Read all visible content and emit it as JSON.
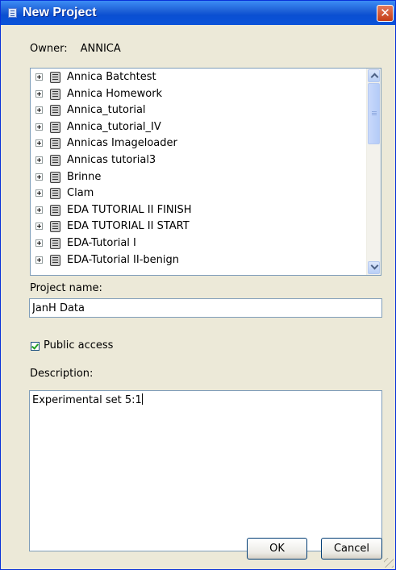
{
  "window": {
    "title": "New Project",
    "close_glyph": "✕"
  },
  "owner": {
    "label": "Owner:",
    "value": "ANNICA"
  },
  "projects": [
    "Annica Batchtest",
    "Annica Homework",
    "Annica_tutorial",
    "Annica_tutorial_IV",
    "Annicas Imageloader",
    "Annicas tutorial3",
    "Brinne",
    "Clam",
    "EDA TUTORIAL II FINISH",
    "EDA TUTORIAL II START",
    "EDA-Tutorial I",
    "EDA-Tutorial II-benign"
  ],
  "project_name": {
    "label": "Project name:",
    "value": "JanH Data"
  },
  "public_access": {
    "label": "Public access",
    "checked": true
  },
  "description": {
    "label": "Description:",
    "value": "Experimental set 5:1"
  },
  "buttons": {
    "ok": "OK",
    "cancel": "Cancel"
  },
  "icons": {
    "title": "database-window-icon",
    "project": "database-icon",
    "expander": "plus-expander-icon"
  }
}
